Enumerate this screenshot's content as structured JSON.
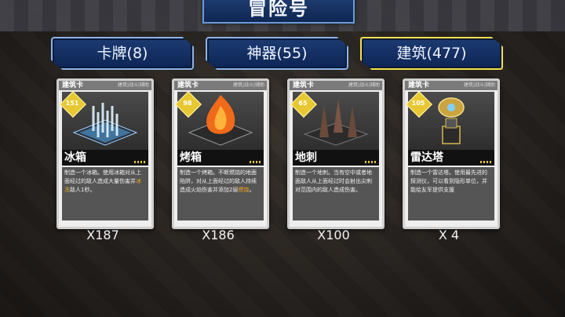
{
  "title": "冒险号",
  "tabs": [
    {
      "label": "卡牌(8)",
      "active": false
    },
    {
      "label": "神器(55)",
      "active": false
    },
    {
      "label": "建筑(477)",
      "active": true
    }
  ],
  "cards": [
    {
      "type": "建筑卡",
      "tags": "建筑|战斗|辅助",
      "cost": "151",
      "name": "冰箱",
      "art": "ice-fountain-icon",
      "desc_parts": [
        "制造一个冰箱。使用冰箱对从上面经过的敌人造成大量伤害并",
        "冰冻",
        "敌人1秒。"
      ],
      "count": "X187"
    },
    {
      "type": "建筑卡",
      "tags": "建筑|战斗|辅助",
      "cost": "98",
      "name": "烤箱",
      "art": "flame-icon",
      "desc_parts": [
        "制造一个烤箱。不断燃烧的地面陷阱，对从上面经过的敌人持续造成火焰伤害并添加2层",
        "燃烧",
        "。"
      ],
      "count": "X186"
    },
    {
      "type": "建筑卡",
      "tags": "建筑|战斗|辅助",
      "cost": "65",
      "name": "地刺",
      "art": "spikes-icon",
      "desc_parts": [
        "制造一个地刺。当有空中或者地面敌人从上面经过时会射出尖刺对范围内的敌人造成伤害。",
        "",
        ""
      ],
      "count": "X100"
    },
    {
      "type": "建筑卡",
      "tags": "建筑|战斗|辅助",
      "cost": "105",
      "name": "雷达塔",
      "art": "radar-tower-icon",
      "desc_parts": [
        "制造一个雷达塔。使用最先进的探测仪，可以看到隐形单位，并能给友军提供支援",
        "",
        ""
      ],
      "count": "X 4"
    }
  ],
  "colors": {
    "tab_bg": "#1d3b72",
    "tab_border": "#8db3e6",
    "active_border": "#f2e04a",
    "cost_gold": "#e8c832",
    "highlight": "#f5a623"
  }
}
